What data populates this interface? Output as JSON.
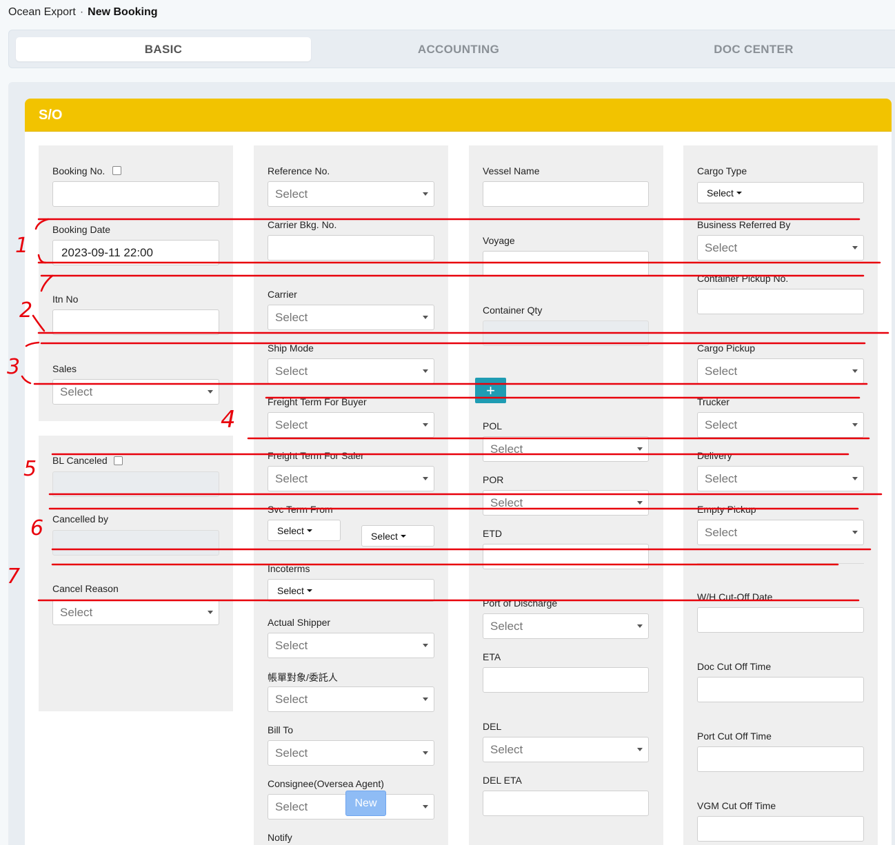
{
  "breadcrumb": {
    "section": "Ocean Export",
    "separator": "·",
    "current": "New Booking"
  },
  "tabs": [
    {
      "label": "BASIC",
      "active": true
    },
    {
      "label": "ACCOUNTING",
      "active": false
    },
    {
      "label": "DOC CENTER",
      "active": false
    }
  ],
  "panel_title": "S/O",
  "select_placeholder": "Select",
  "col1": {
    "booking_no": "Booking No.",
    "booking_date": "Booking Date",
    "booking_date_value": "2023-09-11 22:00",
    "itn_no": "Itn No",
    "sales": "Sales",
    "bl_canceled": "BL Canceled",
    "cancelled_by": "Cancelled by",
    "cancel_reason": "Cancel Reason"
  },
  "col2": {
    "reference_no": "Reference No.",
    "carrier_bkg_no": "Carrier Bkg. No.",
    "carrier": "Carrier",
    "ship_mode": "Ship Mode",
    "freight_term_buyer": "Freight Term For Buyer",
    "freight_term_saler": "Freight Term For Saler",
    "svc_term_from": "Svc Term From",
    "incoterms": "Incoterms",
    "actual_shipper": "Actual Shipper",
    "billing_party": "帳單對象/委託人",
    "bill_to": "Bill To",
    "consignee": "Consignee(Oversea Agent)",
    "new_button": "New",
    "notify": "Notify"
  },
  "col3": {
    "vessel_name": "Vessel Name",
    "voyage": "Voyage",
    "container_qty": "Container Qty",
    "add_button": "+",
    "pol": "POL",
    "por": "POR",
    "etd": "ETD",
    "port_of_discharge": "Port of Discharge",
    "eta": "ETA",
    "del": "DEL",
    "del_eta": "DEL ETA"
  },
  "col4": {
    "cargo_type": "Cargo Type",
    "business_referred_by": "Business Referred By",
    "container_pickup_no": "Container Pickup No.",
    "cargo_pickup": "Cargo Pickup",
    "trucker": "Trucker",
    "delivery": "Delivery",
    "empty_pickup": "Empty Pickup",
    "wh_cutoff_date": "W/H Cut-Off Date",
    "doc_cutoff_time": "Doc Cut Off Time",
    "port_cutoff_time": "Port Cut Off Time",
    "vgm_cutoff_time": "VGM Cut Off Time"
  },
  "annotations": [
    "1",
    "2",
    "3",
    "4",
    "5",
    "6",
    "7"
  ],
  "colors": {
    "header": "#f2c300",
    "annotation": "#e8000b",
    "add_button": "#1f9cb3",
    "new_button": "#8fbcf5"
  }
}
